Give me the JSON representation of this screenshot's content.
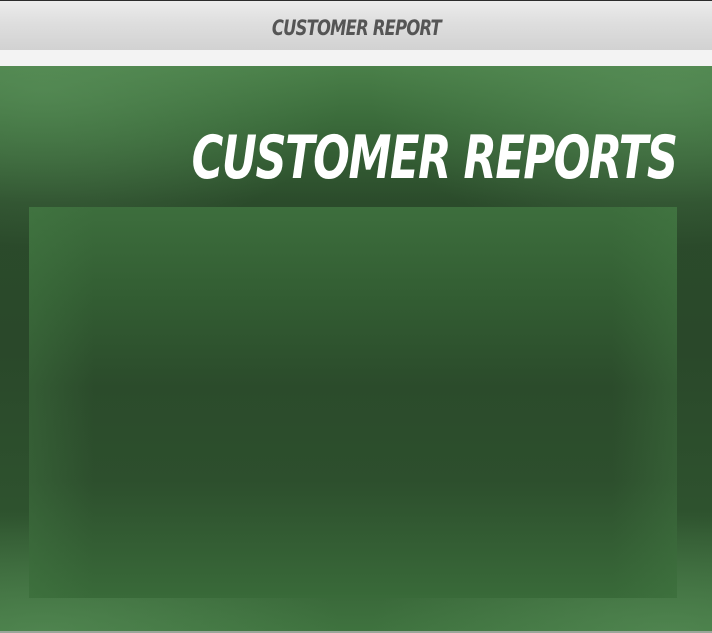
{
  "window": {
    "title": "CUSTOMER REPORT"
  },
  "main": {
    "heading": "CUSTOMER REPORTS"
  },
  "colors": {
    "title_bar": "#dcdcdc",
    "title_text": "#555555",
    "panel_green": "#2b4b2b",
    "heading_text": "#ffffff"
  }
}
